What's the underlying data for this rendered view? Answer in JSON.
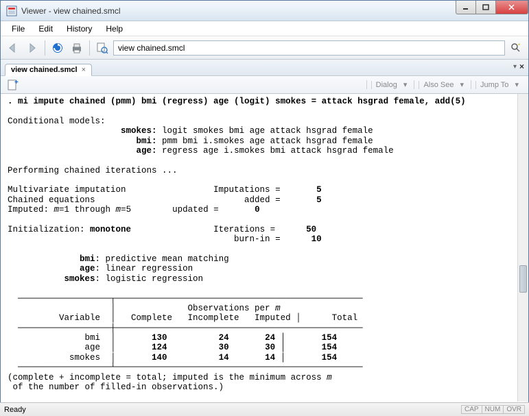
{
  "window": {
    "title": "Viewer - view chained.smcl"
  },
  "menu": {
    "file": "File",
    "edit": "Edit",
    "history": "History",
    "help": "Help"
  },
  "toolbar": {
    "address": "view chained.smcl"
  },
  "tab": {
    "label": "view chained.smcl"
  },
  "secondbar": {
    "dialog": "Dialog",
    "alsosee": "Also See",
    "jumpto": "Jump To"
  },
  "output": {
    "cmd": ". mi impute chained (pmm) bmi (regress) age (logit) smokes = attack hsgrad female, add(5)",
    "cond_hdr": "Conditional models:",
    "cond_smokes_lbl": "smokes:",
    "cond_smokes_val": " logit smokes bmi age attack hsgrad female",
    "cond_bmi_lbl": "bmi:",
    "cond_bmi_val": " pmm bmi i.smokes age attack hsgrad female",
    "cond_age_lbl": "age:",
    "cond_age_val": " regress age i.smokes bmi attack hsgrad female",
    "perform": "Performing chained iterations ...",
    "mv_lbl": "Multivariate imputation",
    "mv_imputations_lbl": "Imputations =",
    "mv_imputations_val": "5",
    "chained_lbl": "Chained equations",
    "chained_added_lbl": "added =",
    "chained_added_val": "5",
    "imputed_lbl_pre": "Imputed: ",
    "imputed_m_txt": "m",
    "imputed_lbl_mid": "=1 through ",
    "imputed_lbl_post": "=5",
    "imputed_updated_lbl": "updated =",
    "imputed_updated_val": "0",
    "init_lbl": "Initialization: ",
    "init_val": "monotone",
    "init_iter_lbl": "Iterations =",
    "init_iter_val": "50",
    "burnin_lbl": "burn-in =",
    "burnin_val": "10",
    "meth_bmi_lbl": "bmi",
    "meth_bmi_val": ": predictive mean matching",
    "meth_age_lbl": "age",
    "meth_age_val": ": linear regression",
    "meth_smokes_lbl": "smokes",
    "meth_smokes_val": ": logistic regression",
    "tbl_header_obs": "Observations per ",
    "tbl_header_m": "m",
    "tbl_var": "Variable",
    "tbl_complete": "Complete",
    "tbl_incomplete": "Incomplete",
    "tbl_imputed": "Imputed",
    "tbl_total": "Total",
    "rows": [
      {
        "var": "bmi",
        "complete": "130",
        "incomplete": "24",
        "imputed": "24",
        "total": "154"
      },
      {
        "var": "age",
        "complete": "124",
        "incomplete": "30",
        "imputed": "30",
        "total": "154"
      },
      {
        "var": "smokes",
        "complete": "140",
        "incomplete": "14",
        "imputed": "14",
        "total": "154"
      }
    ],
    "footer1_pre": "(complete + incomplete = total; imputed is the minimum across ",
    "footer1_m": "m",
    "footer2": " of the number of filled-in observations.)"
  },
  "status": {
    "ready": "Ready",
    "cap": "CAP",
    "num": "NUM",
    "ovr": "OVR"
  }
}
